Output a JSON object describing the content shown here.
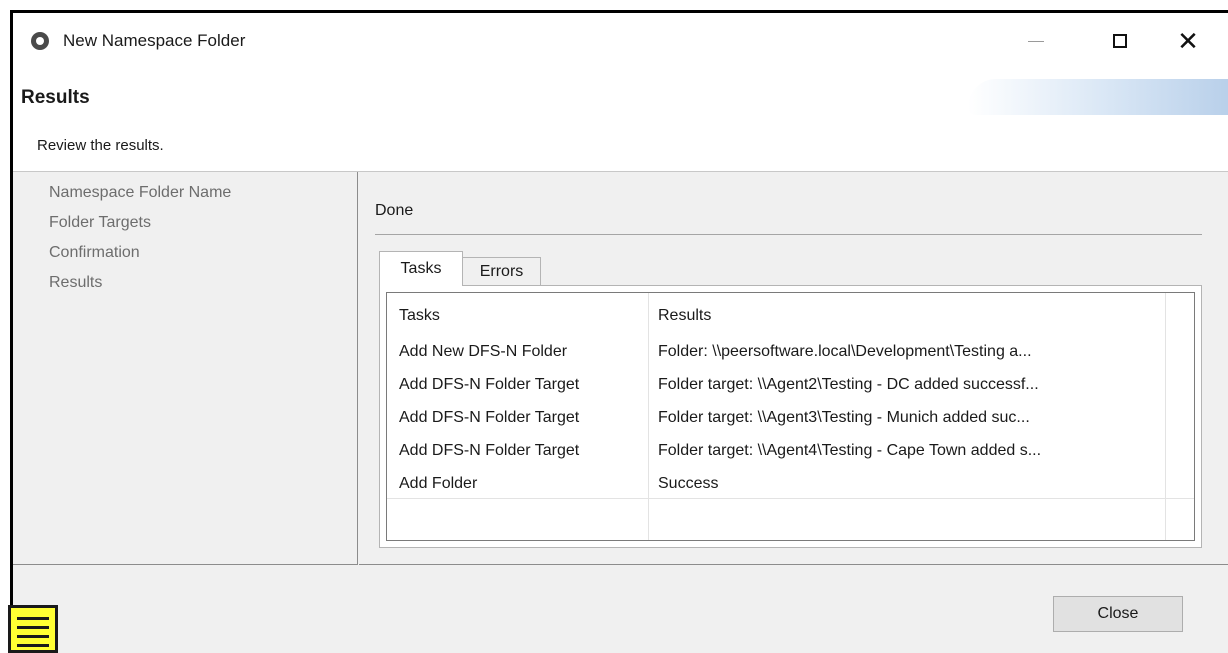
{
  "window": {
    "title": "New Namespace Folder",
    "icon": "peer-software-logo-icon"
  },
  "header": {
    "title": "Results",
    "subtitle": "Review the results."
  },
  "nav": {
    "items": [
      {
        "label": "Namespace Folder Name"
      },
      {
        "label": "Folder Targets"
      },
      {
        "label": "Confirmation"
      },
      {
        "label": "Results"
      }
    ]
  },
  "main": {
    "status": "Done",
    "tabs": [
      {
        "label": "Tasks",
        "selected": true
      },
      {
        "label": "Errors",
        "selected": false
      }
    ],
    "table": {
      "columns": [
        "Tasks",
        "Results"
      ],
      "rows": [
        {
          "task": "Add New DFS-N Folder",
          "result": "Folder: \\\\peersoftware.local\\Development\\Testing a..."
        },
        {
          "task": "Add DFS-N Folder Target",
          "result": "Folder target: \\\\Agent2\\Testing - DC added successf..."
        },
        {
          "task": "Add DFS-N Folder Target",
          "result": "Folder target: \\\\Agent3\\Testing - Munich added suc..."
        },
        {
          "task": "Add DFS-N Folder Target",
          "result": "Folder target: \\\\Agent4\\Testing - Cape Town added s..."
        },
        {
          "task": "Add Folder",
          "result": "Success"
        }
      ]
    }
  },
  "footer": {
    "close_label": "Close"
  },
  "colors": {
    "dialog_background": "#f0f0f0",
    "note_icon_fill": "#ffff33"
  }
}
